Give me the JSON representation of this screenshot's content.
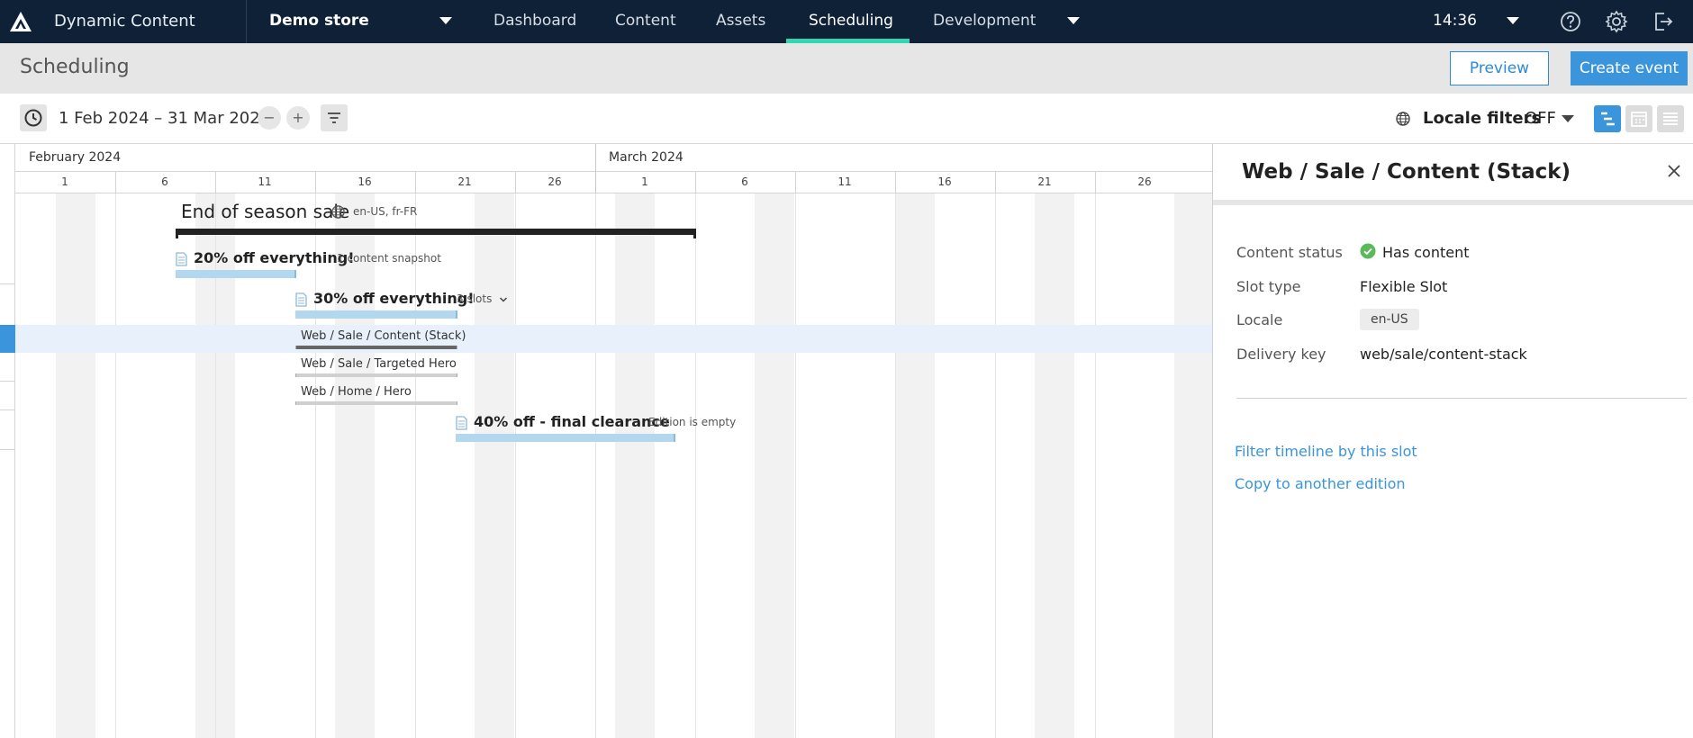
{
  "nav": {
    "app_title": "Dynamic Content",
    "store": "Demo store",
    "tabs": [
      {
        "label": "Dashboard"
      },
      {
        "label": "Content"
      },
      {
        "label": "Assets"
      },
      {
        "label": "Scheduling",
        "active": true
      },
      {
        "label": "Development"
      }
    ],
    "time": "14:36",
    "icons": [
      "logo-icon",
      "help-icon",
      "gear-icon",
      "logout-icon"
    ],
    "accent": "#2fd8b0",
    "background": "#0e2136"
  },
  "header": {
    "title": "Scheduling",
    "preview_label": "Preview",
    "create_label": "Create event"
  },
  "toolbar": {
    "date_range": "1 Feb 2024 – 31 Mar 2024",
    "zoom_out": "−",
    "zoom_in": "+",
    "locale_filters_label": "Locale filters",
    "locale_filters_value": "OFF"
  },
  "timeline": {
    "months": [
      {
        "label": "February 2024"
      },
      {
        "label": "March 2024"
      }
    ],
    "days": [
      "1",
      "6",
      "11",
      "16",
      "21",
      "26",
      "1",
      "6",
      "11",
      "16",
      "21",
      "26"
    ],
    "event": {
      "title": "End of season sale",
      "locales": "en-US, fr-FR"
    },
    "editions": [
      {
        "name": "20% off everything!",
        "meta": "1 content snapshot"
      },
      {
        "name": "30% off everything!",
        "meta": "3 slots"
      },
      {
        "name": "40% off - final clearance",
        "meta": "Edition is empty"
      }
    ],
    "slots": [
      {
        "label": "Web / Sale / Content (Stack)",
        "selected": true
      },
      {
        "label": "Web / Sale / Targeted Hero"
      },
      {
        "label": "Web / Home / Hero"
      }
    ]
  },
  "panel": {
    "title": "Web / Sale / Content (Stack)",
    "properties": [
      {
        "label": "Content status",
        "value": "Has content"
      },
      {
        "label": "Slot type",
        "value": "Flexible Slot"
      },
      {
        "label": "Locale",
        "value": "en-US"
      },
      {
        "label": "Delivery key",
        "value": "web/sale/content-stack"
      }
    ],
    "links": [
      {
        "label": "Filter timeline by this slot"
      },
      {
        "label": "Copy to another edition"
      }
    ],
    "status_color": "#5cb85c",
    "link_color": "#3a95dc"
  }
}
